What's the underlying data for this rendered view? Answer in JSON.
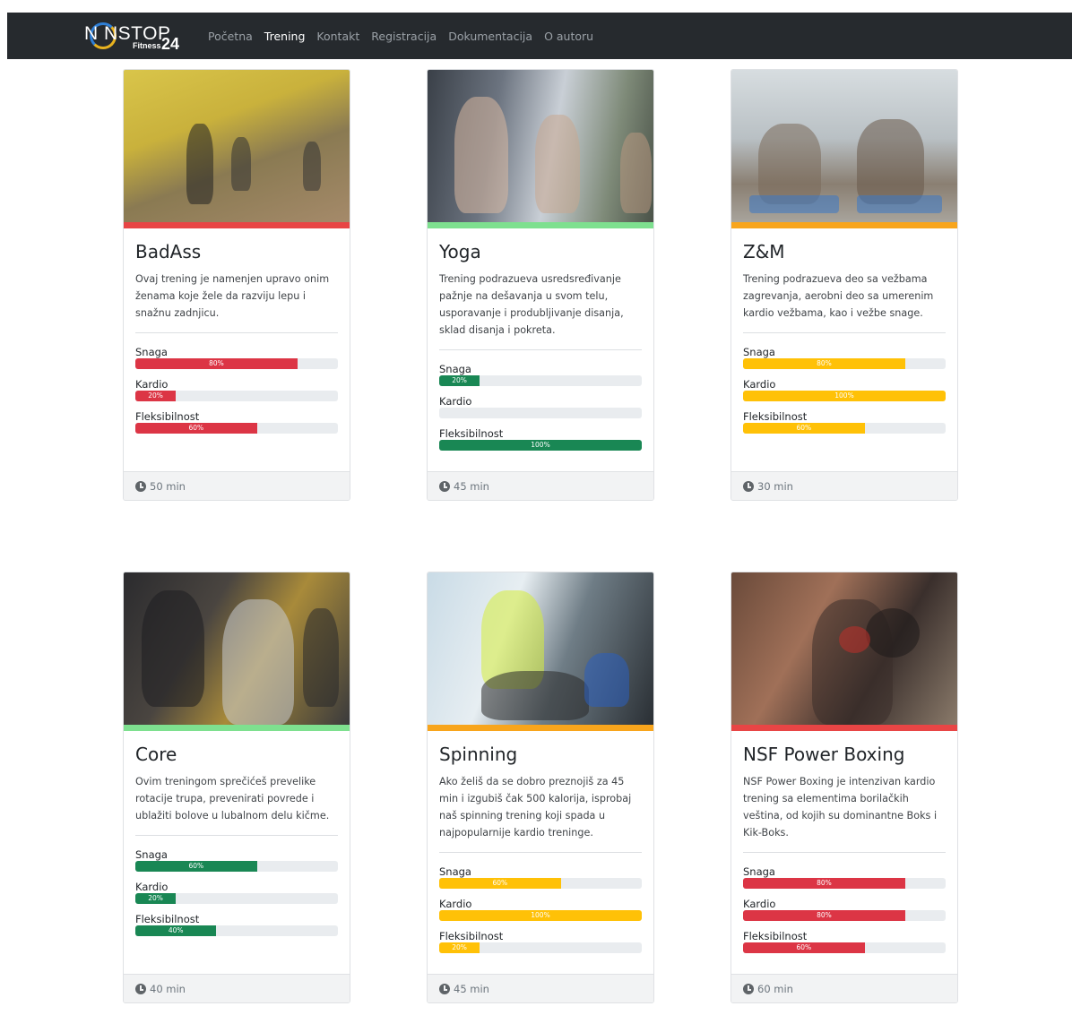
{
  "nav": {
    "logo": {
      "text": "N   NSTOP",
      "sub": "Fitness",
      "num": "24"
    },
    "links": [
      {
        "label": "Početna",
        "active": false
      },
      {
        "label": "Trening",
        "active": true
      },
      {
        "label": "Kontakt",
        "active": false
      },
      {
        "label": "Registracija",
        "active": false
      },
      {
        "label": "Dokumentacija",
        "active": false
      },
      {
        "label": "O autoru",
        "active": false
      }
    ]
  },
  "colors": {
    "red": "#dc3545",
    "green": "#198754",
    "yellow": "#ffc107",
    "stripe_green": "#7ee08f",
    "stripe_orange": "#f8a51c"
  },
  "cards": [
    {
      "title": "BadAss",
      "text": "Ovaj trening je namenjen upravo onim ženama koje žele da razviju lepu i snažnu zadnjicu.",
      "stripe": "#e84545",
      "bar_color": "#dc3545",
      "skills": [
        {
          "label": "Snaga",
          "value": 80,
          "text": "80%"
        },
        {
          "label": "Kardio",
          "value": 20,
          "text": "20%"
        },
        {
          "label": "Fleksibilnost",
          "value": 60,
          "text": "60%"
        }
      ],
      "duration": "50 min"
    },
    {
      "title": "Yoga",
      "text": "Trening podrazueva usredsređivanje pažnje na dešavanja u svom telu, usporavanje i produbljivanje disanja, sklad disanja i pokreta.",
      "stripe": "#7ee08f",
      "bar_color": "#198754",
      "skills": [
        {
          "label": "Snaga",
          "value": 20,
          "text": "20%"
        },
        {
          "label": "Kardio",
          "value": 0,
          "text": ""
        },
        {
          "label": "Fleksibilnost",
          "value": 100,
          "text": "100%"
        }
      ],
      "duration": "45 min"
    },
    {
      "title": "Z&M",
      "text": "Trening podrazueva deo sa vežbama zagrevanja, aerobni deo sa umerenim kardio vežbama, kao i vežbe snage.",
      "stripe": "#f8a51c",
      "bar_color": "#ffc107",
      "skills": [
        {
          "label": "Snaga",
          "value": 80,
          "text": "80%"
        },
        {
          "label": "Kardio",
          "value": 100,
          "text": "100%"
        },
        {
          "label": "Fleksibilnost",
          "value": 60,
          "text": "60%"
        }
      ],
      "duration": "30 min"
    },
    {
      "title": "Core",
      "text": "Ovim treningom sprečićeš prevelike rotacije trupa, prevenirati povrede i ublažiti bolove u lubalnom delu kičme.",
      "stripe": "#7ee08f",
      "bar_color": "#198754",
      "skills": [
        {
          "label": "Snaga",
          "value": 60,
          "text": "60%"
        },
        {
          "label": "Kardio",
          "value": 20,
          "text": "20%"
        },
        {
          "label": "Fleksibilnost",
          "value": 40,
          "text": "40%"
        }
      ],
      "duration": "40 min"
    },
    {
      "title": "Spinning",
      "text": "Ako želiš da se dobro preznojiš za 45 min i izgubiš čak 500 kalorija, isprobaj naš spinning trening koji spada u najpopularnije kardio treninge.",
      "stripe": "#f8a51c",
      "bar_color": "#ffc107",
      "skills": [
        {
          "label": "Snaga",
          "value": 60,
          "text": "60%"
        },
        {
          "label": "Kardio",
          "value": 100,
          "text": "100%"
        },
        {
          "label": "Fleksibilnost",
          "value": 20,
          "text": "20%"
        }
      ],
      "duration": "45 min"
    },
    {
      "title": "NSF Power Boxing",
      "text": "NSF Power Boxing je intenzivan kardio trening sa elementima borilačkih veština, od kojih su dominantne Boks i Kik-Boks.",
      "stripe": "#e84545",
      "bar_color": "#dc3545",
      "skills": [
        {
          "label": "Snaga",
          "value": 80,
          "text": "80%"
        },
        {
          "label": "Kardio",
          "value": 80,
          "text": "80%"
        },
        {
          "label": "Fleksibilnost",
          "value": 60,
          "text": "60%"
        }
      ],
      "duration": "60 min"
    }
  ]
}
